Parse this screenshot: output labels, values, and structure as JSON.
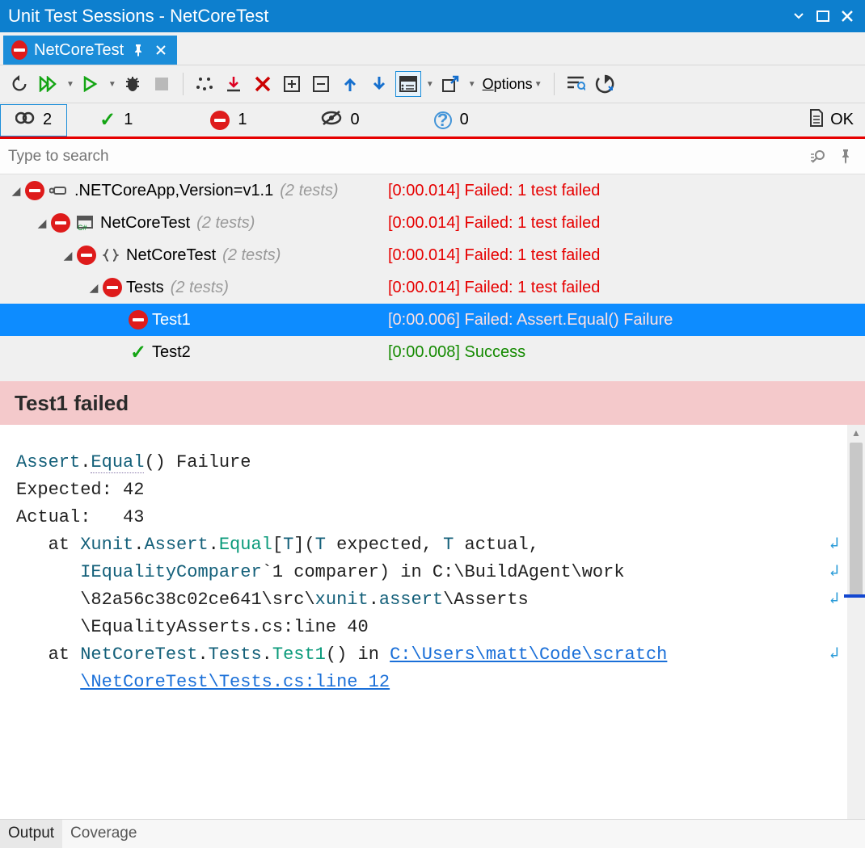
{
  "window": {
    "title": "Unit Test Sessions - NetCoreTest"
  },
  "tab": {
    "label": "NetCoreTest"
  },
  "toolbar": {
    "options_label": "Options"
  },
  "filters": {
    "total": "2",
    "passed": "1",
    "failed": "1",
    "skipped": "0",
    "ignored": "0",
    "status_label": "OK"
  },
  "search": {
    "placeholder": "Type to search"
  },
  "tree": [
    {
      "indent": 0,
      "arrow": true,
      "status": "fail",
      "type_icon": "framework",
      "name": ".NETCoreApp,Version=v1.1",
      "count": "(2 tests)",
      "result": "[0:00.014] Failed: 1 test failed",
      "result_class": "fail",
      "selected": false
    },
    {
      "indent": 1,
      "arrow": true,
      "status": "fail",
      "type_icon": "project",
      "name": "NetCoreTest",
      "count": "(2 tests)",
      "result": "[0:00.014] Failed: 1 test failed",
      "result_class": "fail",
      "selected": false
    },
    {
      "indent": 2,
      "arrow": true,
      "status": "fail",
      "type_icon": "namespace",
      "name": "NetCoreTest",
      "count": "(2 tests)",
      "result": "[0:00.014] Failed: 1 test failed",
      "result_class": "fail",
      "selected": false
    },
    {
      "indent": 3,
      "arrow": true,
      "status": "fail",
      "type_icon": "",
      "name": "Tests",
      "count": "(2 tests)",
      "result": "[0:00.014] Failed: 1 test failed",
      "result_class": "fail",
      "selected": false
    },
    {
      "indent": 4,
      "arrow": false,
      "status": "fail",
      "type_icon": "",
      "name": "Test1",
      "count": "",
      "result": "[0:00.006] Failed: Assert.Equal() Failure",
      "result_class": "fail",
      "selected": true
    },
    {
      "indent": 4,
      "arrow": false,
      "status": "pass",
      "type_icon": "",
      "name": "Test2",
      "count": "",
      "result": "[0:00.008] Success",
      "result_class": "pass",
      "selected": false
    }
  ],
  "result_header": "Test1 failed",
  "output": {
    "text_line1_a": "Assert",
    "text_line1_b": ".",
    "text_line1_c": "Equal",
    "text_line1_d": "() Failure",
    "line2": "Expected: 42",
    "line3": "Actual:   43",
    "line4_pre": "   at ",
    "line4_a": "Xunit",
    "line4_b": ".",
    "line4_c": "Assert",
    "line4_d": ".",
    "line4_e": "Equal",
    "line4_f": "[",
    "line4_g": "T",
    "line4_h": "](",
    "line4_i": "T",
    "line4_j": " expected, ",
    "line4_k": "T",
    "line4_l": " actual, ",
    "line5_pre": "      ",
    "line5_a": "IEqualityComparer",
    "line5_b": "`1 comparer) in C:\\BuildAgent\\work",
    "line6": "      \\82a56c38c02ce641\\src\\",
    "line6_a": "xunit",
    "line6_b": ".",
    "line6_c": "assert",
    "line6_d": "\\Asserts",
    "line7": "      \\EqualityAsserts.cs:line 40",
    "line8_pre": "   at ",
    "line8_a": "NetCoreTest",
    "line8_b": ".",
    "line8_c": "Tests",
    "line8_d": ".",
    "line8_e": "Test1",
    "line8_f": "() in ",
    "line8_link1": "C:\\Users\\matt\\Code\\scratch",
    "line9_pre": "      ",
    "line9_link": "\\NetCoreTest\\Tests.cs:line 12"
  },
  "bottom_tabs": {
    "output": "Output",
    "coverage": "Coverage"
  }
}
